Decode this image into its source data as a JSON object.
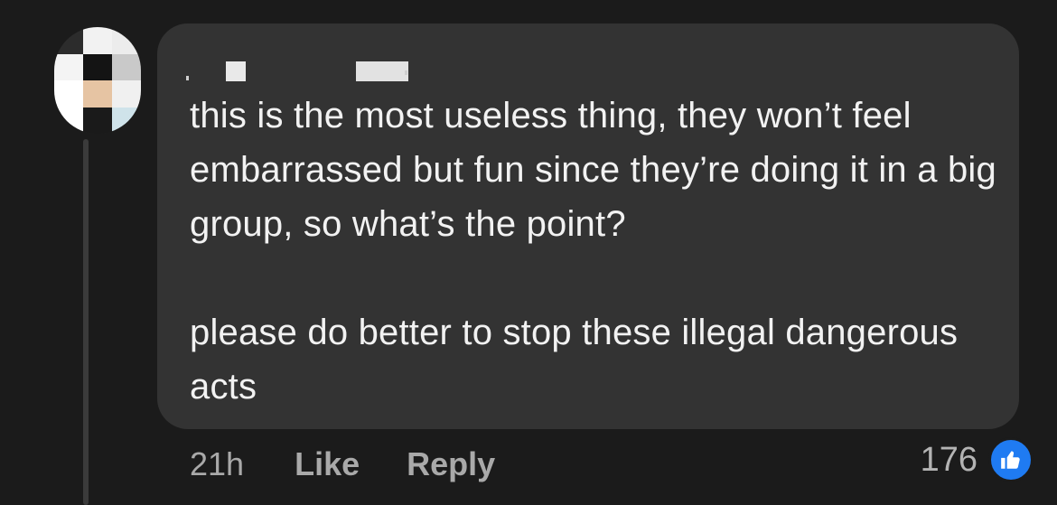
{
  "comment": {
    "text_paragraphs": [
      "this is the most useless thing, they won’t feel embarrassed but fun since they’re doing it in a big group, so what’s the point?",
      "please do better to stop these illegal dangerous acts"
    ],
    "time": "21h",
    "like_label": "Like",
    "reply_label": "Reply",
    "reaction_count": "176",
    "reaction_icon": "thumbs-up-icon"
  },
  "colors": {
    "background": "#1b1b1b",
    "bubble": "#333333",
    "text": "#f2f2f2",
    "muted": "#a9a9a9",
    "like_blue": "#1f7bf2"
  }
}
